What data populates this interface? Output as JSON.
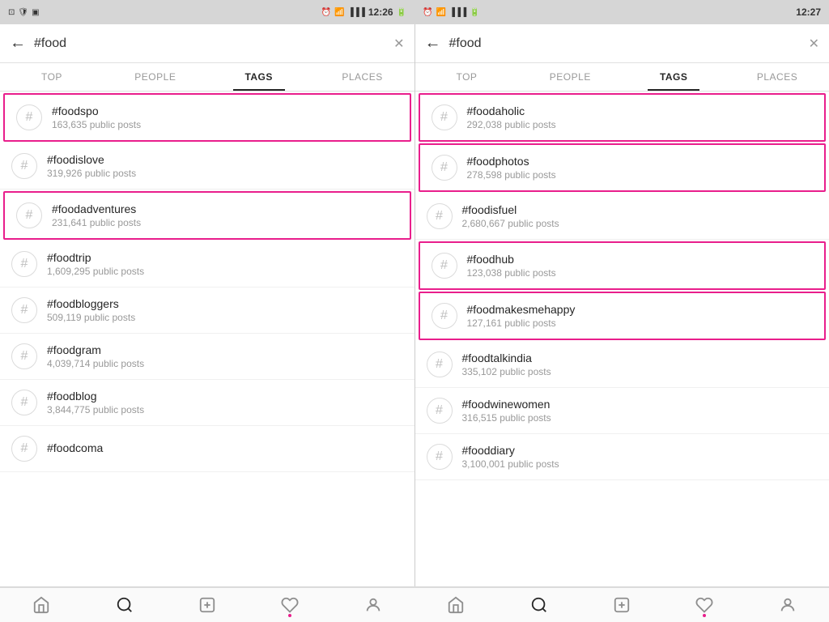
{
  "statusBar": {
    "left": {
      "time": "12:26",
      "leftIcons": [
        "sim-icon",
        "shield-icon",
        "media-icon"
      ],
      "rightIcons": [
        "alarm-icon",
        "wifi-icon",
        "signal-icon",
        "battery-icon"
      ]
    },
    "right": {
      "time": "12:27",
      "leftIcons": [
        "alarm-icon",
        "wifi-icon",
        "signal-icon",
        "battery-icon"
      ]
    }
  },
  "panels": [
    {
      "id": "left",
      "searchText": "#food",
      "tabs": [
        {
          "label": "TOP",
          "active": false
        },
        {
          "label": "PEOPLE",
          "active": false
        },
        {
          "label": "TAGS",
          "active": true
        },
        {
          "label": "PLACES",
          "active": false
        }
      ],
      "tags": [
        {
          "name": "#foodspo",
          "count": "163,635 public posts",
          "highlighted": true
        },
        {
          "name": "#foodislove",
          "count": "319,926 public posts",
          "highlighted": false
        },
        {
          "name": "#foodadventures",
          "count": "231,641 public posts",
          "highlighted": true
        },
        {
          "name": "#foodtrip",
          "count": "1,609,295 public posts",
          "highlighted": false
        },
        {
          "name": "#foodbloggers",
          "count": "509,119 public posts",
          "highlighted": false
        },
        {
          "name": "#foodgram",
          "count": "4,039,714 public posts",
          "highlighted": false
        },
        {
          "name": "#foodblog",
          "count": "3,844,775 public posts",
          "highlighted": false
        },
        {
          "name": "#foodcoma",
          "count": "",
          "highlighted": false
        }
      ]
    },
    {
      "id": "right",
      "searchText": "#food",
      "tabs": [
        {
          "label": "TOP",
          "active": false
        },
        {
          "label": "PEOPLE",
          "active": false
        },
        {
          "label": "TAGS",
          "active": true
        },
        {
          "label": "PLACES",
          "active": false
        }
      ],
      "tags": [
        {
          "name": "#foodaholic",
          "count": "292,038 public posts",
          "highlighted": true
        },
        {
          "name": "#foodphotos",
          "count": "278,598 public posts",
          "highlighted": true
        },
        {
          "name": "#foodisfuel",
          "count": "2,680,667 public posts",
          "highlighted": false
        },
        {
          "name": "#foodhub",
          "count": "123,038 public posts",
          "highlighted": true
        },
        {
          "name": "#foodmakesmehappy",
          "count": "127,161 public posts",
          "highlighted": true
        },
        {
          "name": "#foodtalkindia",
          "count": "335,102 public posts",
          "highlighted": false
        },
        {
          "name": "#foodwinewomen",
          "count": "316,515 public posts",
          "highlighted": false
        },
        {
          "name": "#fooddiary",
          "count": "3,100,001 public posts",
          "highlighted": false
        }
      ]
    }
  ],
  "bottomNav": {
    "items": [
      {
        "icon": "home-icon",
        "active": false
      },
      {
        "icon": "search-icon",
        "active": true
      },
      {
        "icon": "add-icon",
        "active": false
      },
      {
        "icon": "heart-icon",
        "active": false,
        "dot": true
      },
      {
        "icon": "profile-icon",
        "active": false
      }
    ]
  },
  "colors": {
    "highlight": "#e91e8c",
    "activeTab": "#262626",
    "inactiveTab": "#999",
    "tagText": "#262626",
    "countText": "#999",
    "hashColor": "#c7c7c7"
  }
}
